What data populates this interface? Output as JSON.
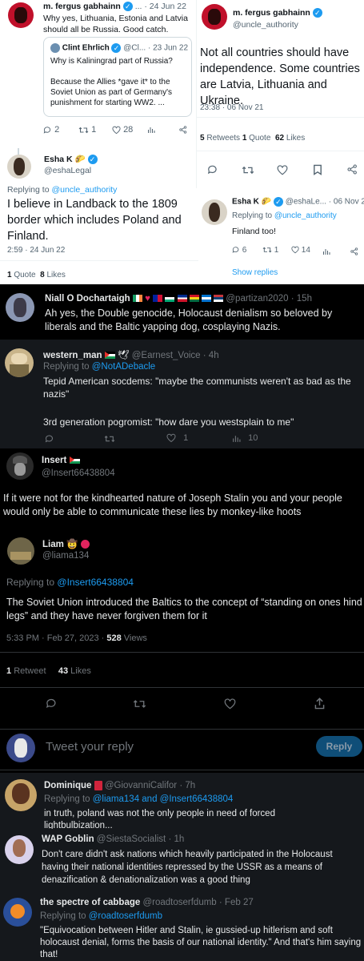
{
  "p1": {
    "left": {
      "name": "m. fergus gabhainn",
      "handle_tail": "...",
      "date": "· 24 Jun 22",
      "text": "Why yes, Lithuania, Estonia and Latvia should all be Russia.  Good catch.",
      "quote": {
        "name": "Clint Ehrlich",
        "handle": "@Cl...",
        "date": "· 23 Jun 22",
        "text1": "Why is Kaliningrad part of Russia?",
        "text2": "Because the Allies *gave it* to the Soviet Union as part of Germany's punishment for starting WW2. ..."
      },
      "actions": {
        "replies": "2",
        "retweets": "1",
        "likes": "28"
      }
    },
    "right": {
      "name": "m. fergus gabhainn",
      "handle": "@uncle_authority",
      "text": "Not all countries should have independence.  Some countries are Latvia, Lithuania and Ukraine.",
      "time": "23:38 · 06 Nov 21",
      "retweets_n": "5",
      "retweets_l": "Retweets",
      "quote_n": "1",
      "quote_l": "Quote",
      "likes_n": "62",
      "likes_l": "Likes"
    },
    "esha_left": {
      "name": "Esha K",
      "handle": "@eshaLegal",
      "replying": "Replying to",
      "replying_to": "@uncle_authority",
      "text": "I believe in Landback to the 1809 border which includes Poland and Finland.",
      "time": "2:59 · 24 Jun 22",
      "quote_n": "1",
      "quote_l": "Quote",
      "likes_n": "8",
      "likes_l": "Likes"
    },
    "esha_right": {
      "name": "Esha K",
      "handle": "@eshaLe...",
      "date": "· 06 Nov 21",
      "replying": "Replying to",
      "replying_to": "@uncle_authority",
      "text": "Finland too!",
      "actions": {
        "replies": "6",
        "retweets": "1",
        "likes": "14"
      },
      "show_replies": "Show replies"
    }
  },
  "niall": {
    "name": "Niall O Dochartaigh",
    "handle": "@partizan2020",
    "date": "· 15h",
    "text": "Ah yes, the Double genocide, Holocaust denialism so beloved by liberals and the Baltic yapping dog, cosplaying Nazis."
  },
  "western": {
    "name": "western_man",
    "handle": "@Earnest_Voice",
    "date": "· 4h",
    "replying": "Replying to",
    "replying_to": "@NotADebacle",
    "text1": "Tepid American socdems: \"maybe the communists weren't as bad as the nazis\"",
    "text2": "3rd generation pogromist: \"how dare you westsplain to me\"",
    "actions": {
      "likes": "1",
      "views": "10"
    }
  },
  "insert": {
    "name": "Insert",
    "handle": "@Insert66438804",
    "text": "If it were not for the kindhearted nature of Joseph Stalin you and your people would only be able to communicate these lies by monkey-like hoots"
  },
  "liam": {
    "name": "Liam",
    "handle": "@liama134",
    "replying": "Replying to",
    "replying_to": "@Insert66438804",
    "text": "The Soviet Union introduced the Baltics to the concept of “standing on ones hind legs” and they have never forgiven them for it",
    "time": "5:33 PM · Feb 27, 2023 ·",
    "views_n": "528",
    "views_l": "Views",
    "retweet_n": "1",
    "retweet_l": "Retweet",
    "likes_n": "43",
    "likes_l": "Likes"
  },
  "compose": {
    "placeholder": "Tweet your reply",
    "reply_button": "Reply"
  },
  "dominique": {
    "name": "Dominique",
    "handle": "@GiovanniCalifor",
    "date": "· 7h",
    "replying": "Replying to",
    "replying_to": "@liama134 and @Insert66438804",
    "text": "in truth, poland was not the only people in need of forced lightbulbization..."
  },
  "wap": {
    "name": "WAP Goblin",
    "handle": "@SiestaSocialist",
    "date": "· 1h",
    "text": "Don't care didn't ask nations which heavily participated in the Holocaust having their national identities repressed by the USSR as a means of denazification & denationalization was a good thing"
  },
  "spectre": {
    "name": "the spectre of cabbage",
    "handle": "@roadtoserfdumb",
    "date": "· Feb 27",
    "replying": "Replying to",
    "replying_to": "@roadtoserfdumb",
    "text": "\"Equivocation between Hitler and Stalin, ie gussied-up hitlerism and soft holocaust denial, forms the basis of our national identity.\" And that's him saying that!"
  }
}
